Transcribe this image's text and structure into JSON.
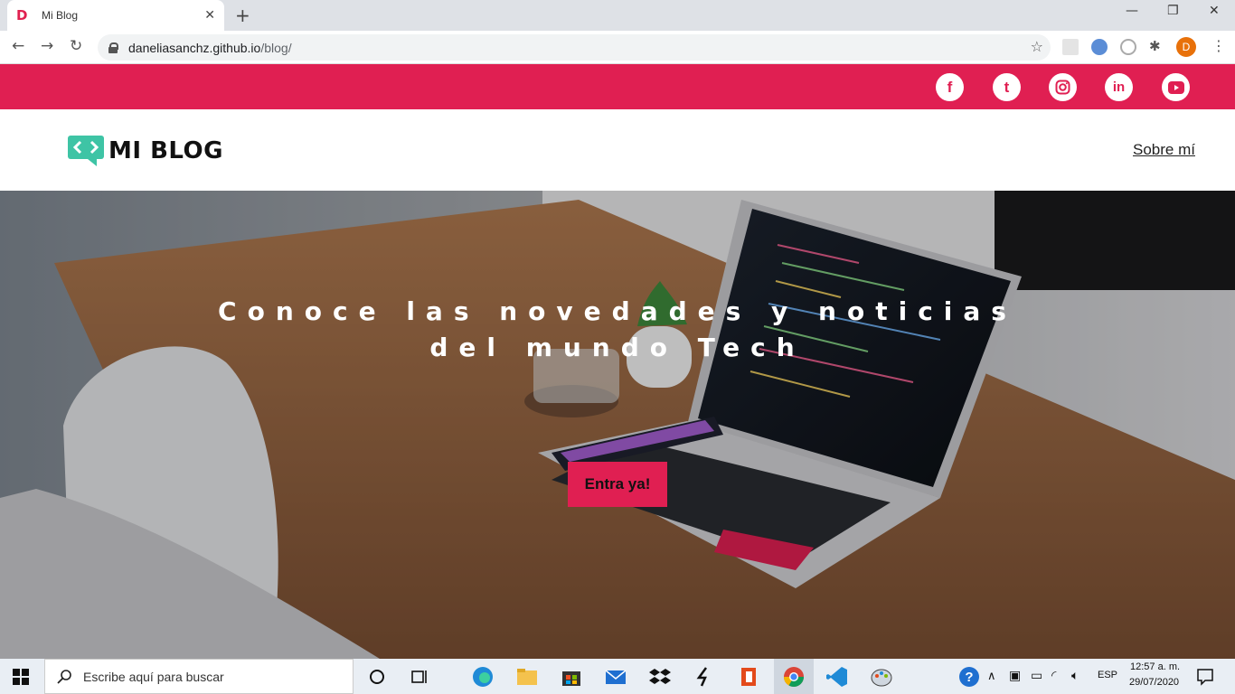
{
  "browser": {
    "tab_title": "Mi Blog",
    "favicon_letter": "D",
    "url_host": "daneliasanchz.github.io",
    "url_path": "/blog/",
    "profile_initial": "D"
  },
  "social": [
    {
      "name": "facebook",
      "glyph": "f"
    },
    {
      "name": "tumblr",
      "glyph": "t"
    },
    {
      "name": "instagram",
      "glyph": ""
    },
    {
      "name": "linkedin",
      "glyph": "in"
    },
    {
      "name": "youtube",
      "glyph": ""
    }
  ],
  "header": {
    "logo_text": "MI BLOG",
    "nav_about": "Sobre mí"
  },
  "hero": {
    "title": "Conoce las novedades y noticias del mundo Tech",
    "cta": "Entra ya!"
  },
  "taskbar": {
    "search_placeholder": "Escribe aquí para buscar",
    "language": "ESP",
    "time": "12:57 a. m.",
    "date": "29/07/2020"
  },
  "colors": {
    "accent": "#e01f52",
    "logo_green": "#3ec4a5"
  }
}
